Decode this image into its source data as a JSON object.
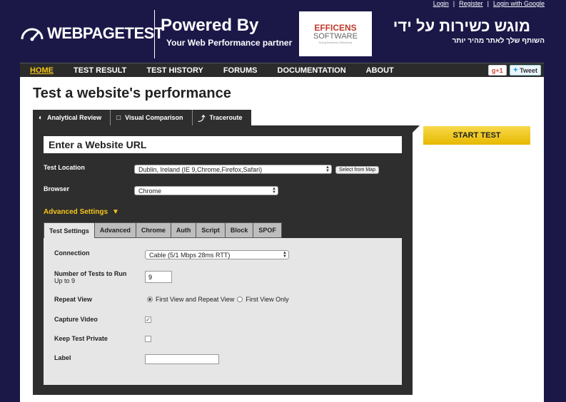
{
  "toplinks": {
    "login": "Login",
    "register": "Register",
    "login_google": "Login with Google",
    "sep": "|"
  },
  "header": {
    "logo_text": "WEBPAGETEST",
    "powered_by": "Powered By",
    "partner_tagline": "Your Web Performance partner",
    "partner_logo_line1": "EFFICENS",
    "partner_logo_line2": "SOFTWARE",
    "partner_logo_tiny": "Doing Business Effectively",
    "hebrew_title": "מוגש כשירות על ידי",
    "hebrew_subtitle": "השותף שלך לאתר מהיר יותר"
  },
  "nav": {
    "items": [
      "HOME",
      "TEST RESULT",
      "TEST HISTORY",
      "FORUMS",
      "DOCUMENTATION",
      "ABOUT"
    ],
    "gplus": "g+1",
    "tweet": "Tweet"
  },
  "main": {
    "title": "Test a website's performance",
    "tabs": [
      "Analytical Review",
      "Visual Comparison",
      "Traceroute"
    ],
    "url_placeholder": "Enter a Website URL",
    "test_location_label": "Test Location",
    "test_location_value": "Dublin, Ireland (IE 9,Chrome,Firefox,Safari)",
    "select_from_map": "Select from Map",
    "browser_label": "Browser",
    "browser_value": "Chrome",
    "advanced_settings": "Advanced Settings",
    "start_test": "START TEST"
  },
  "advanced": {
    "tabs": [
      "Test Settings",
      "Advanced",
      "Chrome",
      "Auth",
      "Script",
      "Block",
      "SPOF"
    ],
    "connection_label": "Connection",
    "connection_value": "Cable (5/1 Mbps 28ms RTT)",
    "num_tests_label": "Number of Tests to Run",
    "num_tests_sub": "Up to 9",
    "num_tests_value": "9",
    "repeat_view_label": "Repeat View",
    "repeat_opt1": "First View and Repeat View",
    "repeat_opt2": "First View Only",
    "capture_video_label": "Capture Video",
    "capture_video_checked": true,
    "keep_private_label": "Keep Test Private",
    "keep_private_checked": false,
    "label_label": "Label"
  }
}
